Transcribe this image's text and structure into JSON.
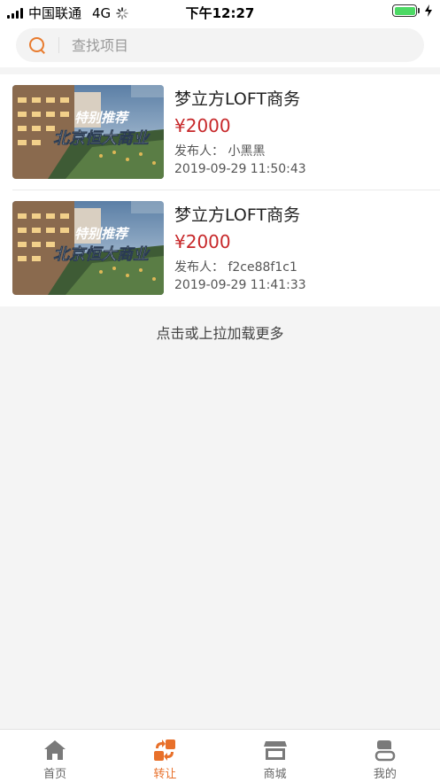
{
  "status_bar": {
    "carrier": "中国联通",
    "network": "4G",
    "time": "下午12:27"
  },
  "search": {
    "placeholder": "查找项目",
    "icon": "search-icon",
    "accent_color": "#e87b2e"
  },
  "listings": [
    {
      "title": "梦立方LOFT商务",
      "price": "¥2000",
      "publisher": "发布人：  小黑黑",
      "date": "2019-09-29 11:50:43",
      "image_caption_top": "特别推荐",
      "image_caption_main": "北京恒大商业"
    },
    {
      "title": "梦立方LOFT商务",
      "price": "¥2000",
      "publisher": "发布人：  f2ce88f1c1",
      "date": "2019-09-29 11:41:33",
      "image_caption_top": "特别推荐",
      "image_caption_main": "北京恒大商业"
    }
  ],
  "load_more": "点击或上拉加载更多",
  "tabs": [
    {
      "label": "首页",
      "icon": "home-icon",
      "active": false
    },
    {
      "label": "转让",
      "icon": "transfer-icon",
      "active": true
    },
    {
      "label": "商城",
      "icon": "store-icon",
      "active": false
    },
    {
      "label": "我的",
      "icon": "profile-icon",
      "active": false
    }
  ],
  "colors": {
    "price": "#c7282a",
    "active_tab": "#e8702a",
    "inactive_tab": "#7a7a7a"
  }
}
